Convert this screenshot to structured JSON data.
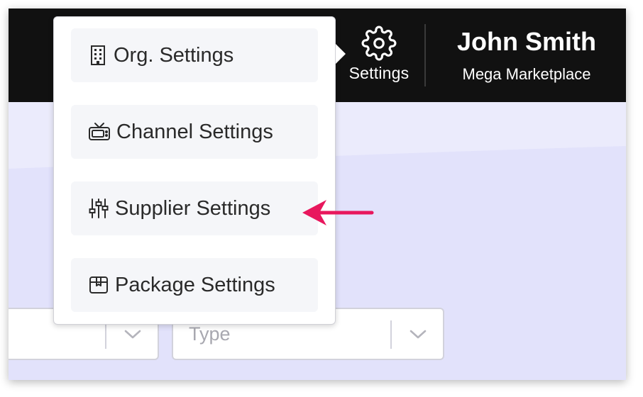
{
  "header": {
    "settings_label": "Settings",
    "user_name": "John Smith",
    "org_name": "Mega Marketplace"
  },
  "filters": {
    "type_placeholder": "Type"
  },
  "settings_menu": {
    "items": [
      {
        "label": "Org. Settings",
        "icon": "building-icon"
      },
      {
        "label": "Channel Settings",
        "icon": "tv-icon"
      },
      {
        "label": "Supplier Settings",
        "icon": "sliders-icon"
      },
      {
        "label": "Package Settings",
        "icon": "package-icon"
      }
    ]
  },
  "annotation": {
    "arrow_color": "#e8175d",
    "points_to": "Supplier Settings"
  },
  "colors": {
    "topbar": "#111111",
    "page_background": "#e6e6fb",
    "menu_item_background": "#f5f6f9"
  }
}
